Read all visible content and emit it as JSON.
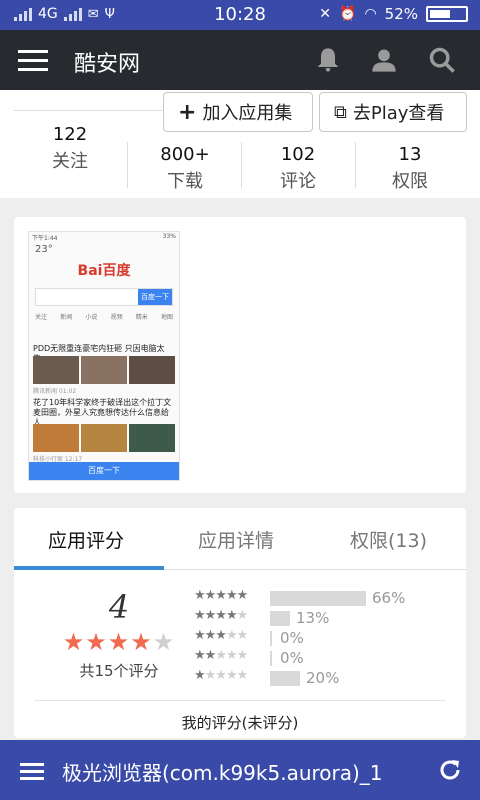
{
  "status_bar": {
    "network": "4G",
    "time": "10:28",
    "battery": "52%"
  },
  "app_bar": {
    "title": "酷安网",
    "icons": [
      "menu-icon",
      "bell-icon",
      "user-icon",
      "search-icon"
    ]
  },
  "actions": {
    "add_collection": "加入应用集",
    "play_store": "去Play查看"
  },
  "stats": [
    {
      "value": "122",
      "label": "关注"
    },
    {
      "value": "800+",
      "label": "下载"
    },
    {
      "value": "102",
      "label": "评论"
    },
    {
      "value": "13",
      "label": "权限"
    }
  ],
  "screenshot": {
    "status_left": "下午1:44",
    "status_right": "33%",
    "temp": "23°",
    "logo": "Bai百度",
    "search_button": "百度一下",
    "nav": [
      "关注",
      "新闻",
      "小说",
      "视频",
      "精米",
      "地图"
    ],
    "news1_title": "PDD无限重连豪宅内狂砸 只因电脑太牛...",
    "news1_meta": "腾讯新闻  01:02",
    "news2_title": "花了10年科学家终于破译出这个拉丁文麦田圈，外星人究竟想传达什么信息给人...",
    "news2_meta": "科技小行家  12:17",
    "bottom_label": "百度一下"
  },
  "rating_tabs": [
    {
      "label": "应用评分",
      "active": true
    },
    {
      "label": "应用详情",
      "active": false
    },
    {
      "label": "权限(13)",
      "active": false
    }
  ],
  "rating": {
    "score": "4",
    "stars_on": 4,
    "total_text": "共15个评分",
    "distribution": [
      {
        "stars": 5,
        "percent": 66,
        "label": "66%"
      },
      {
        "stars": 4,
        "percent": 13,
        "label": "13%"
      },
      {
        "stars": 3,
        "percent": 0,
        "label": "0%"
      },
      {
        "stars": 2,
        "percent": 0,
        "label": "0%"
      },
      {
        "stars": 1,
        "percent": 20,
        "label": "20%"
      }
    ],
    "my_rating": "我的评分(未评分)"
  },
  "bottom_bar": {
    "title": "极光浏览器(com.k99k5.aurora)_1",
    "icons": [
      "menu-icon",
      "refresh-icon"
    ]
  },
  "colors": {
    "status_bar": "#3a4aa8",
    "app_bar": "#272b30",
    "star_active": "#ef6a4e",
    "tab_indicator": "#3a8ad8"
  }
}
